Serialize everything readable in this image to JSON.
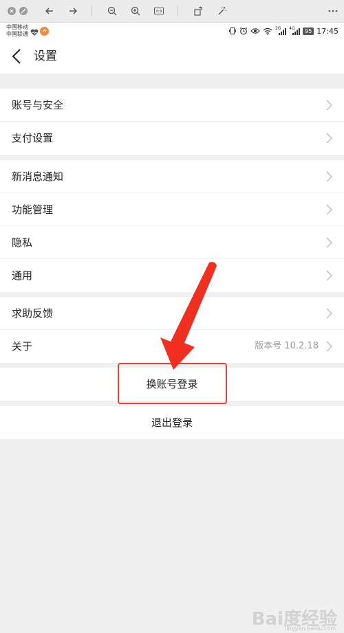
{
  "status_bar": {
    "carrier_1": "中国移动",
    "carrier_2": "中国联通",
    "battery": "95",
    "time": "17:45",
    "signal_1": "2G",
    "signal_2": "4G"
  },
  "header": {
    "title": "设置"
  },
  "groups": [
    {
      "items": [
        {
          "label": "账号与安全"
        },
        {
          "label": "支付设置"
        }
      ]
    },
    {
      "items": [
        {
          "label": "新消息通知"
        },
        {
          "label": "功能管理"
        },
        {
          "label": "隐私"
        },
        {
          "label": "通用"
        }
      ]
    },
    {
      "items": [
        {
          "label": "求助反馈"
        },
        {
          "label": "关于",
          "value": "版本号 10.2.18"
        }
      ]
    }
  ],
  "actions": {
    "switch_account": "换账号登录",
    "logout": "退出登录"
  },
  "watermark": {
    "text": "Bai度经验",
    "sub": "jingyan.baidu.com"
  },
  "colors": {
    "annotation_red": "#e8403a",
    "page_bg": "#f0f0f0",
    "chevron": "#bbbbbb"
  }
}
